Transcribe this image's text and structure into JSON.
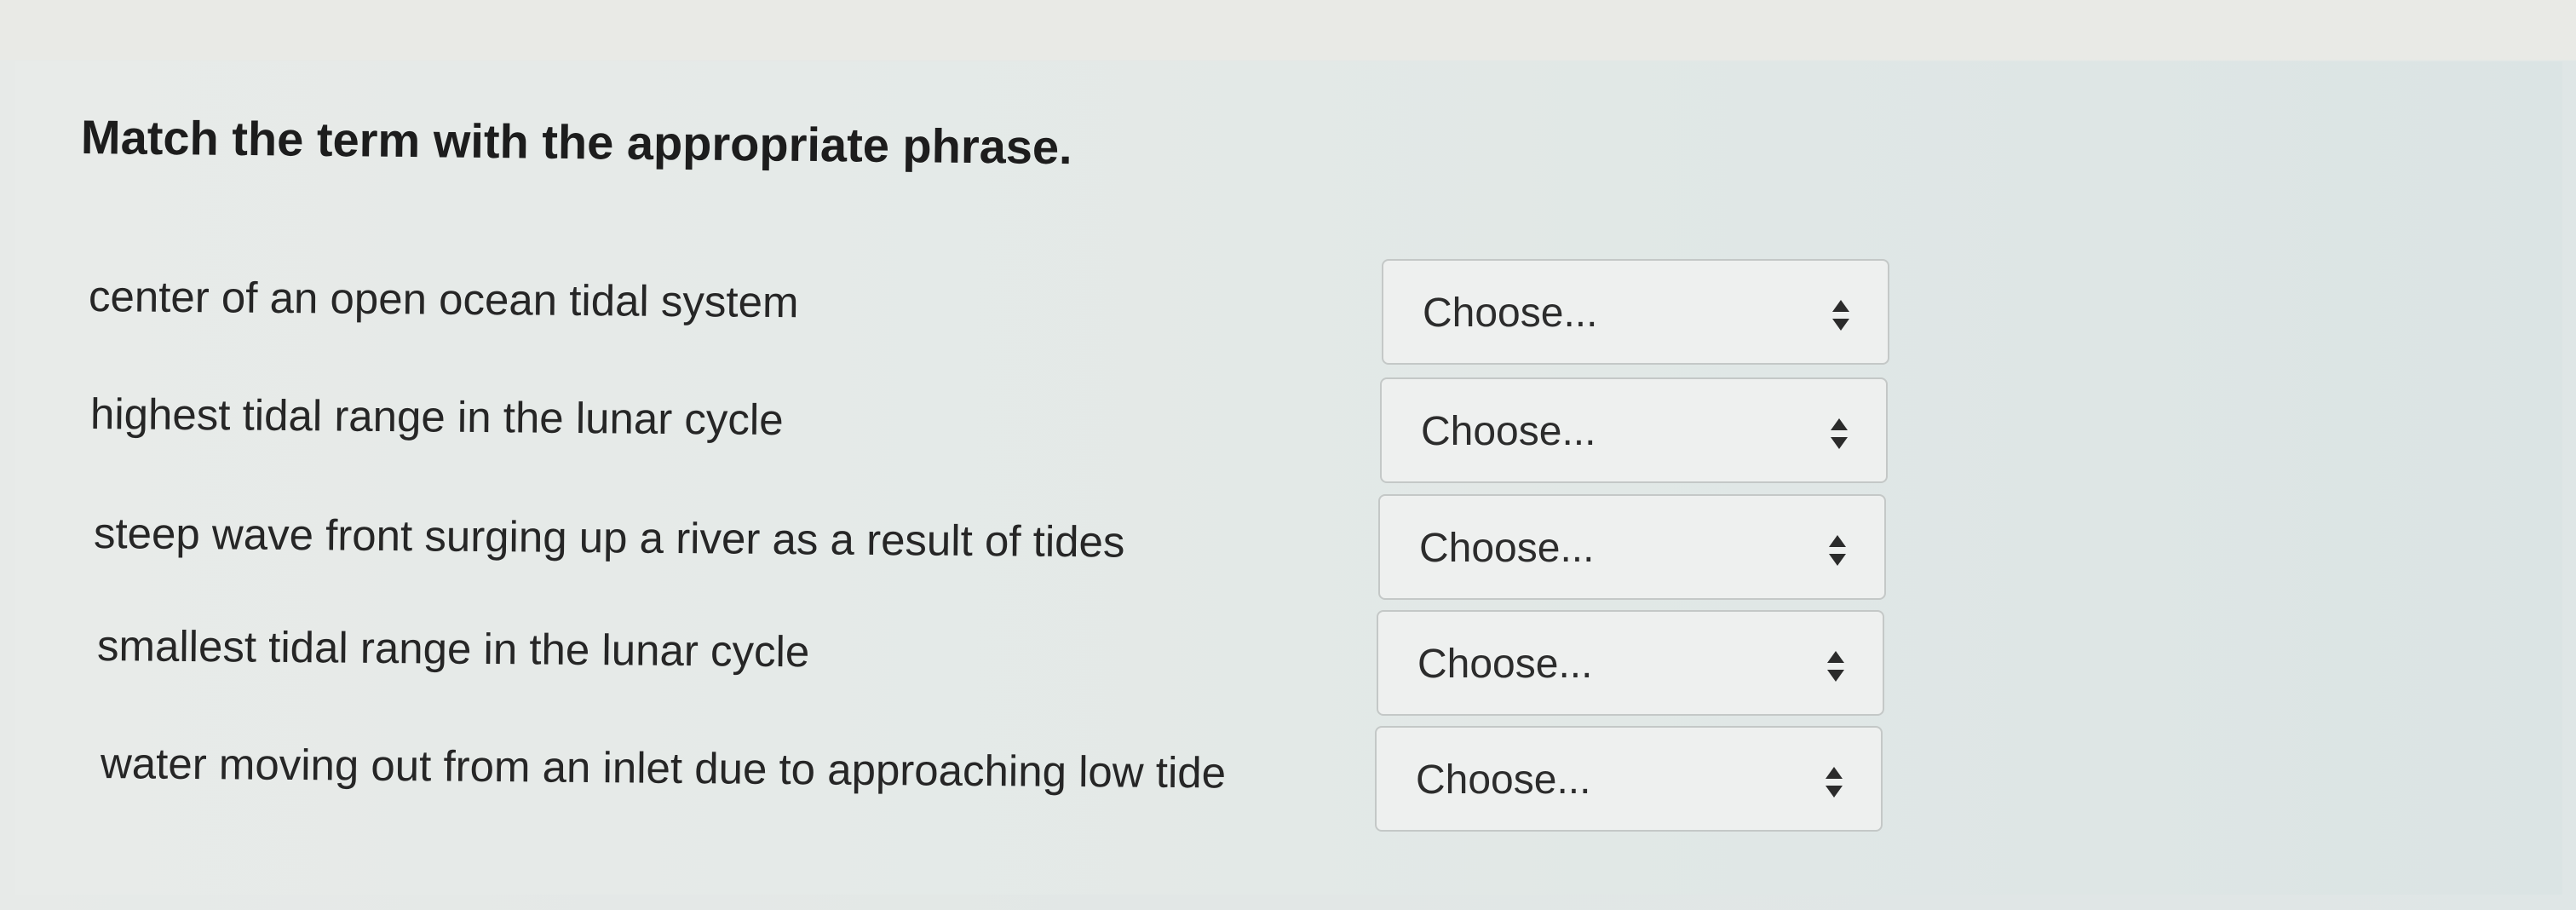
{
  "question": {
    "title": "Match the term with the appropriate phrase."
  },
  "rows": [
    {
      "term": "center of an open ocean tidal system",
      "selected": "Choose..."
    },
    {
      "term": "highest tidal range in the lunar cycle",
      "selected": "Choose..."
    },
    {
      "term": "steep wave front surging up a river as a result of tides",
      "selected": "Choose..."
    },
    {
      "term": "smallest tidal range in the lunar cycle",
      "selected": "Choose..."
    },
    {
      "term": "water moving out from an inlet due to approaching low tide",
      "selected": "Choose..."
    }
  ],
  "icons": {
    "select_indicator": "up-down-arrows-icon"
  },
  "colors": {
    "text": "#262626",
    "select_border": "#c4c8c7",
    "select_bg": "#eef0ef"
  }
}
